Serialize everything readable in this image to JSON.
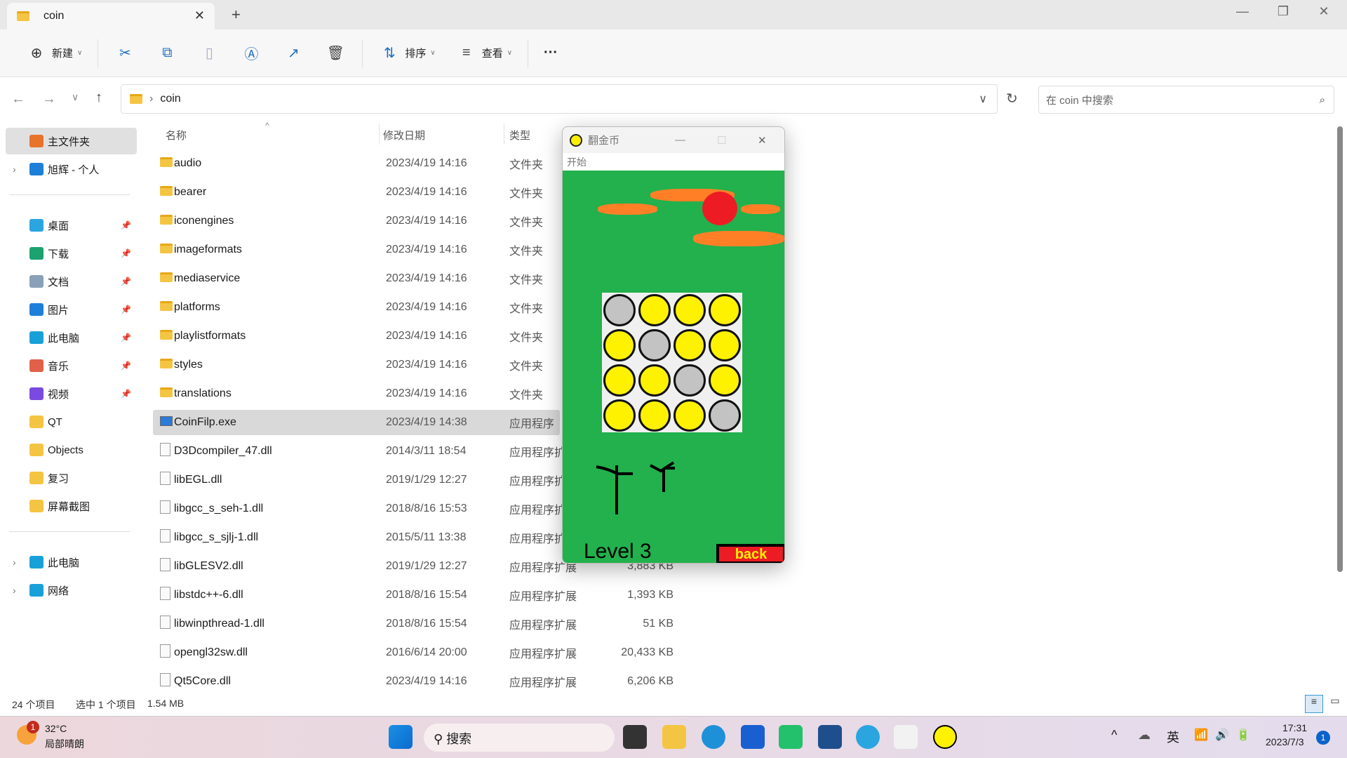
{
  "tab": {
    "title": "coin",
    "new_tab": "+"
  },
  "window_controls": {
    "minimize": "—",
    "maximize": "❐",
    "close": "✕"
  },
  "toolbar": {
    "new": "新建",
    "sort": "排序",
    "view": "查看",
    "more": "···"
  },
  "address": {
    "path": "coin",
    "search_placeholder": "在 coin 中搜索"
  },
  "sidebar": {
    "items": [
      {
        "label": "主文件夹",
        "icon": "home-icon",
        "color": "#e8732a"
      },
      {
        "label": "旭辉 - 个人",
        "icon": "onedrive-icon",
        "color": "#1e7fd8"
      },
      {
        "label": "桌面",
        "icon": "desktop-icon",
        "color": "#2aa5e0",
        "pinned": true
      },
      {
        "label": "下载",
        "icon": "download-icon",
        "color": "#1ba26e",
        "pinned": true
      },
      {
        "label": "文档",
        "icon": "document-icon",
        "color": "#8aa0b8",
        "pinned": true
      },
      {
        "label": "图片",
        "icon": "pictures-icon",
        "color": "#1e7fd8",
        "pinned": true
      },
      {
        "label": "此电脑",
        "icon": "computer-icon",
        "color": "#1aa0d8",
        "pinned": true
      },
      {
        "label": "音乐",
        "icon": "music-icon",
        "color": "#e0604a",
        "pinned": true
      },
      {
        "label": "视频",
        "icon": "video-icon",
        "color": "#7a4ae0",
        "pinned": true
      },
      {
        "label": "QT",
        "icon": "folder-icon",
        "color": "#f4c542"
      },
      {
        "label": "Objects",
        "icon": "folder-icon",
        "color": "#f4c542"
      },
      {
        "label": "复习",
        "icon": "folder-icon",
        "color": "#f4c542"
      },
      {
        "label": "屏幕截图",
        "icon": "folder-icon",
        "color": "#f4c542"
      },
      {
        "label": "此电脑",
        "icon": "computer-icon",
        "color": "#1aa0d8"
      },
      {
        "label": "网络",
        "icon": "network-icon",
        "color": "#1aa0d8"
      }
    ]
  },
  "columns": {
    "name": "名称",
    "date": "修改日期",
    "type": "类型"
  },
  "files": [
    {
      "name": "audio",
      "date": "2023/4/19 14:16",
      "type": "文件夹",
      "size": "",
      "kind": "folder"
    },
    {
      "name": "bearer",
      "date": "2023/4/19 14:16",
      "type": "文件夹",
      "size": "",
      "kind": "folder"
    },
    {
      "name": "iconengines",
      "date": "2023/4/19 14:16",
      "type": "文件夹",
      "size": "",
      "kind": "folder"
    },
    {
      "name": "imageformats",
      "date": "2023/4/19 14:16",
      "type": "文件夹",
      "size": "",
      "kind": "folder"
    },
    {
      "name": "mediaservice",
      "date": "2023/4/19 14:16",
      "type": "文件夹",
      "size": "",
      "kind": "folder"
    },
    {
      "name": "platforms",
      "date": "2023/4/19 14:16",
      "type": "文件夹",
      "size": "",
      "kind": "folder"
    },
    {
      "name": "playlistformats",
      "date": "2023/4/19 14:16",
      "type": "文件夹",
      "size": "",
      "kind": "folder"
    },
    {
      "name": "styles",
      "date": "2023/4/19 14:16",
      "type": "文件夹",
      "size": "",
      "kind": "folder"
    },
    {
      "name": "translations",
      "date": "2023/4/19 14:16",
      "type": "文件夹",
      "size": "",
      "kind": "folder"
    },
    {
      "name": "CoinFilp.exe",
      "date": "2023/4/19 14:38",
      "type": "应用程序",
      "size": "",
      "kind": "exe",
      "selected": true
    },
    {
      "name": "D3Dcompiler_47.dll",
      "date": "2014/3/11 18:54",
      "type": "应用程序扩展",
      "size": "",
      "kind": "dll"
    },
    {
      "name": "libEGL.dll",
      "date": "2019/1/29 12:27",
      "type": "应用程序扩展",
      "size": "",
      "kind": "dll"
    },
    {
      "name": "libgcc_s_seh-1.dll",
      "date": "2018/8/16 15:53",
      "type": "应用程序扩展",
      "size": "",
      "kind": "dll"
    },
    {
      "name": "libgcc_s_sjlj-1.dll",
      "date": "2015/5/11 13:38",
      "type": "应用程序扩展",
      "size": "",
      "kind": "dll"
    },
    {
      "name": "libGLESV2.dll",
      "date": "2019/1/29 12:27",
      "type": "应用程序扩展",
      "size": "3,883 KB",
      "kind": "dll"
    },
    {
      "name": "libstdc++-6.dll",
      "date": "2018/8/16 15:54",
      "type": "应用程序扩展",
      "size": "1,393 KB",
      "kind": "dll"
    },
    {
      "name": "libwinpthread-1.dll",
      "date": "2018/8/16 15:54",
      "type": "应用程序扩展",
      "size": "51 KB",
      "kind": "dll"
    },
    {
      "name": "opengl32sw.dll",
      "date": "2016/6/14 20:00",
      "type": "应用程序扩展",
      "size": "20,433 KB",
      "kind": "dll"
    },
    {
      "name": "Qt5Core.dll",
      "date": "2023/4/19 14:16",
      "type": "应用程序扩展",
      "size": "6,206 KB",
      "kind": "dll"
    }
  ],
  "status": {
    "count": "24 个项目",
    "selected": "选中 1 个项目",
    "size": "1.54 MB"
  },
  "game": {
    "title": "翻金币",
    "menu": "开始",
    "level": "Level 3",
    "back": "back",
    "board": [
      [
        "silver",
        "gold",
        "gold",
        "gold"
      ],
      [
        "gold",
        "silver",
        "gold",
        "gold"
      ],
      [
        "gold",
        "gold",
        "silver",
        "gold"
      ],
      [
        "gold",
        "gold",
        "gold",
        "silver"
      ]
    ],
    "colors": {
      "field": "#22b14c",
      "gold": "#fff200",
      "silver": "#c3c3c3",
      "sun": "#ed1c24",
      "cloud": "#ff7f27"
    }
  },
  "taskbar": {
    "weather_temp": "32°C",
    "weather_desc": "局部晴朗",
    "weather_badge": "1",
    "search": "搜索",
    "ime": "英",
    "time": "17:31",
    "date": "2023/7/3",
    "notifications": "1"
  }
}
